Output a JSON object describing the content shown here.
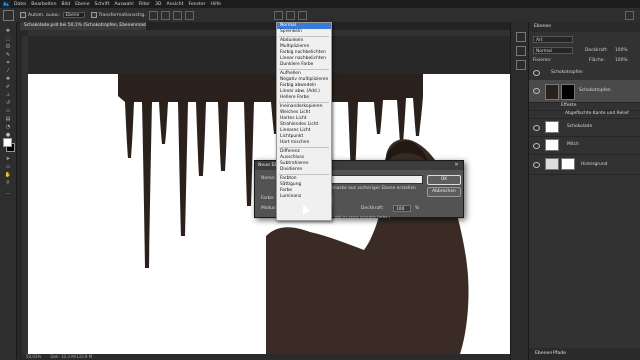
{
  "menu": {
    "logo": "Ps",
    "items": [
      "Datei",
      "Bearbeiten",
      "Bild",
      "Ebene",
      "Schrift",
      "Auswahl",
      "Filter",
      "3D",
      "Ansicht",
      "Fenster",
      "Hilfe"
    ]
  },
  "options": {
    "autoselect_label": "Autom. ausw.:",
    "autoselect_value": "Ebene",
    "transform_label": "Transformationsstrg."
  },
  "document": {
    "tab_title": "Schokolade.psd bei 50,1% (Schokotropfen, Ebenenmaske/8) *",
    "status_zoom": "50,03%",
    "status_info": "Dok: 10,3 M/133,9 M"
  },
  "blend_menu": {
    "groups": [
      [
        "Normal",
        "Sprenkeln"
      ],
      [
        "Abdunkeln",
        "Multiplizieren",
        "Farbig nachbelichten",
        "Linear nachbelichten",
        "Dunklere Farbe"
      ],
      [
        "Aufhellen",
        "Negativ multiplizieren",
        "Farbig abwedeln",
        "Linear abw. (Add.)",
        "Hellere Farbe"
      ],
      [
        "Ineinanderkopieren",
        "Weiches Licht",
        "Hartes Licht",
        "Strahlendes Licht",
        "Lineares Licht",
        "Lichtpunkt",
        "Hart mischen"
      ],
      [
        "Differenz",
        "Ausschluss",
        "Subtrahieren",
        "Dividieren"
      ],
      [
        "Farbton",
        "Sättigung",
        "Farbe",
        "Luminanz"
      ]
    ],
    "selected": "Normal"
  },
  "dialog": {
    "title": "Neue Ebene",
    "name_label": "Name:",
    "use_label": "Schnittmaske aus vorheriger Ebene erstellen",
    "color_label": "Farbe:",
    "mode_label": "Modus:",
    "mode_value": "Normal",
    "opacity_label": "Deckkraft:",
    "opacity_value": "100",
    "opacity_unit": "%",
    "hint": "(Für den Modus „Normal“ gibt es keine neutrale Farbe.)",
    "ok": "OK",
    "cancel": "Abbrechen"
  },
  "panel": {
    "tab": "Ebenen",
    "kind_label": "Art",
    "blend_value": "Normal",
    "opacity_label": "Deckkraft:",
    "opacity_value": "100%",
    "lock_label": "Fixieren:",
    "fill_label": "Fläche:",
    "fill_value": "100%",
    "layers": [
      {
        "name": "Schokotropfen"
      },
      {
        "name": "Schokotropfen"
      },
      {
        "name": "Effekte"
      },
      {
        "name": "Abgeflachte Kante und Relief"
      },
      {
        "name": "Schokolade"
      },
      {
        "name": "Mitch"
      },
      {
        "name": "Hintergrund"
      }
    ],
    "bottom_tabs": [
      "Ebenen",
      "Pfade"
    ]
  },
  "colors": {
    "accent": "#3a7bd5",
    "chocolate": "#2b211c",
    "skin": "#3a2c25",
    "dialog_green": "#3e8a2a"
  }
}
